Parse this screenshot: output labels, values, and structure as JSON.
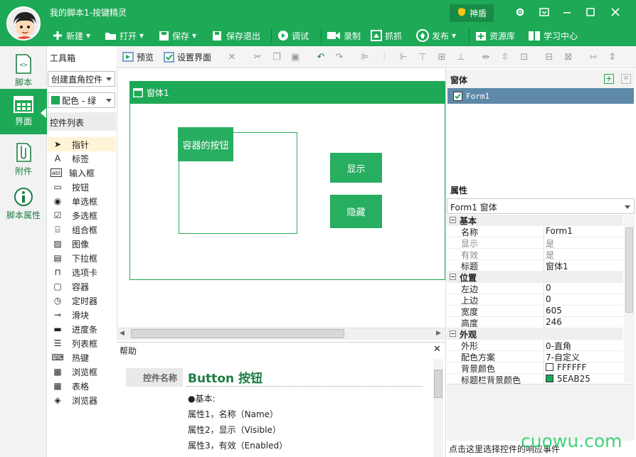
{
  "app": {
    "title": "我的脚本1-按键精灵"
  },
  "shield": {
    "label": "神盾"
  },
  "toolbar": [
    {
      "label": "新建",
      "icon": "plus-icon",
      "dropdown": true
    },
    {
      "label": "打开",
      "icon": "folder-icon",
      "dropdown": true
    },
    {
      "label": "保存",
      "icon": "save-icon",
      "dropdown": true
    },
    {
      "label": "保存退出",
      "icon": "save-exit-icon"
    },
    {
      "label": "调试",
      "icon": "play-icon"
    },
    {
      "label": "录制",
      "icon": "camera-icon"
    },
    {
      "label": "抓抓",
      "icon": "capture-icon"
    },
    {
      "label": "发布",
      "icon": "publish-icon",
      "dropdown": true
    },
    {
      "label": "资源库",
      "icon": "resource-icon"
    },
    {
      "label": "学习中心",
      "icon": "book-icon"
    }
  ],
  "nav": [
    {
      "label": "脚本",
      "icon": "script-icon"
    },
    {
      "label": "界面",
      "icon": "interface-icon",
      "active": true
    },
    {
      "label": "附件",
      "icon": "attachment-icon"
    },
    {
      "label": "脚本属性",
      "icon": "info-icon"
    }
  ],
  "toolbox": {
    "title": "工具箱",
    "mode": "创建直角控件",
    "scheme": "配色 - 绿",
    "list_header": "控件列表",
    "items": [
      {
        "label": "指针",
        "icon": "pointer-icon"
      },
      {
        "label": "标签",
        "icon": "label-icon"
      },
      {
        "label": "输入框",
        "icon": "textbox-icon"
      },
      {
        "label": "按钮",
        "icon": "button-icon"
      },
      {
        "label": "单选框",
        "icon": "radio-icon"
      },
      {
        "label": "多选框",
        "icon": "checkbox-icon"
      },
      {
        "label": "组合框",
        "icon": "groupbox-icon"
      },
      {
        "label": "图像",
        "icon": "image-icon"
      },
      {
        "label": "下拉框",
        "icon": "combobox-icon"
      },
      {
        "label": "选项卡",
        "icon": "tab-icon"
      },
      {
        "label": "容器",
        "icon": "container-icon"
      },
      {
        "label": "定时器",
        "icon": "timer-icon"
      },
      {
        "label": "滑块",
        "icon": "slider-icon"
      },
      {
        "label": "进度条",
        "icon": "progress-icon"
      },
      {
        "label": "列表框",
        "icon": "listbox-icon"
      },
      {
        "label": "热键",
        "icon": "hotkey-icon"
      },
      {
        "label": "浏览框",
        "icon": "browse-icon"
      },
      {
        "label": "表格",
        "icon": "grid-icon"
      },
      {
        "label": "浏览器",
        "icon": "browser-icon"
      }
    ]
  },
  "toolbar2": {
    "preview": "预览",
    "setup_ui": "设置界面"
  },
  "design": {
    "form_title": "窗体1",
    "container_button": "容器的按钮",
    "show_button": "显示",
    "hide_button": "隐藏"
  },
  "help": {
    "title": "帮助",
    "name_label": "控件名称",
    "heading": "Button 按钮",
    "lines": [
      "●基本:",
      "属性1，名称（Name）",
      "属性2，显示（Visible）",
      "属性3，有效（Enabled）"
    ]
  },
  "forms_panel": {
    "title": "窗体",
    "item": "Form1"
  },
  "props": {
    "title": "属性",
    "selector": "Form1 窗体",
    "groups": [
      {
        "name": "基本",
        "rows": [
          {
            "k": "名称",
            "v": "Form1"
          },
          {
            "k": "显示",
            "v": "是",
            "disabled": true
          },
          {
            "k": "有效",
            "v": "是",
            "disabled": true
          },
          {
            "k": "标题",
            "v": "窗体1"
          }
        ]
      },
      {
        "name": "位置",
        "rows": [
          {
            "k": "左边",
            "v": "0"
          },
          {
            "k": "上边",
            "v": "0"
          },
          {
            "k": "宽度",
            "v": "605"
          },
          {
            "k": "高度",
            "v": "246"
          }
        ]
      },
      {
        "name": "外观",
        "rows": [
          {
            "k": "外形",
            "v": "0-直角"
          },
          {
            "k": "配色方案",
            "v": "7-自定义"
          },
          {
            "k": "背景颜色",
            "v": "FFFFFF",
            "swatch": "#FFFFFF"
          },
          {
            "k": "标题栏背景颜色",
            "v": "5EAB25",
            "swatch": "#1ea956"
          }
        ]
      }
    ]
  },
  "status": {
    "text": "点击这里选择控件的响应事件"
  },
  "watermark": "cuowu.com",
  "colors": {
    "brand": "#1ea956",
    "button": "#27ae60"
  }
}
